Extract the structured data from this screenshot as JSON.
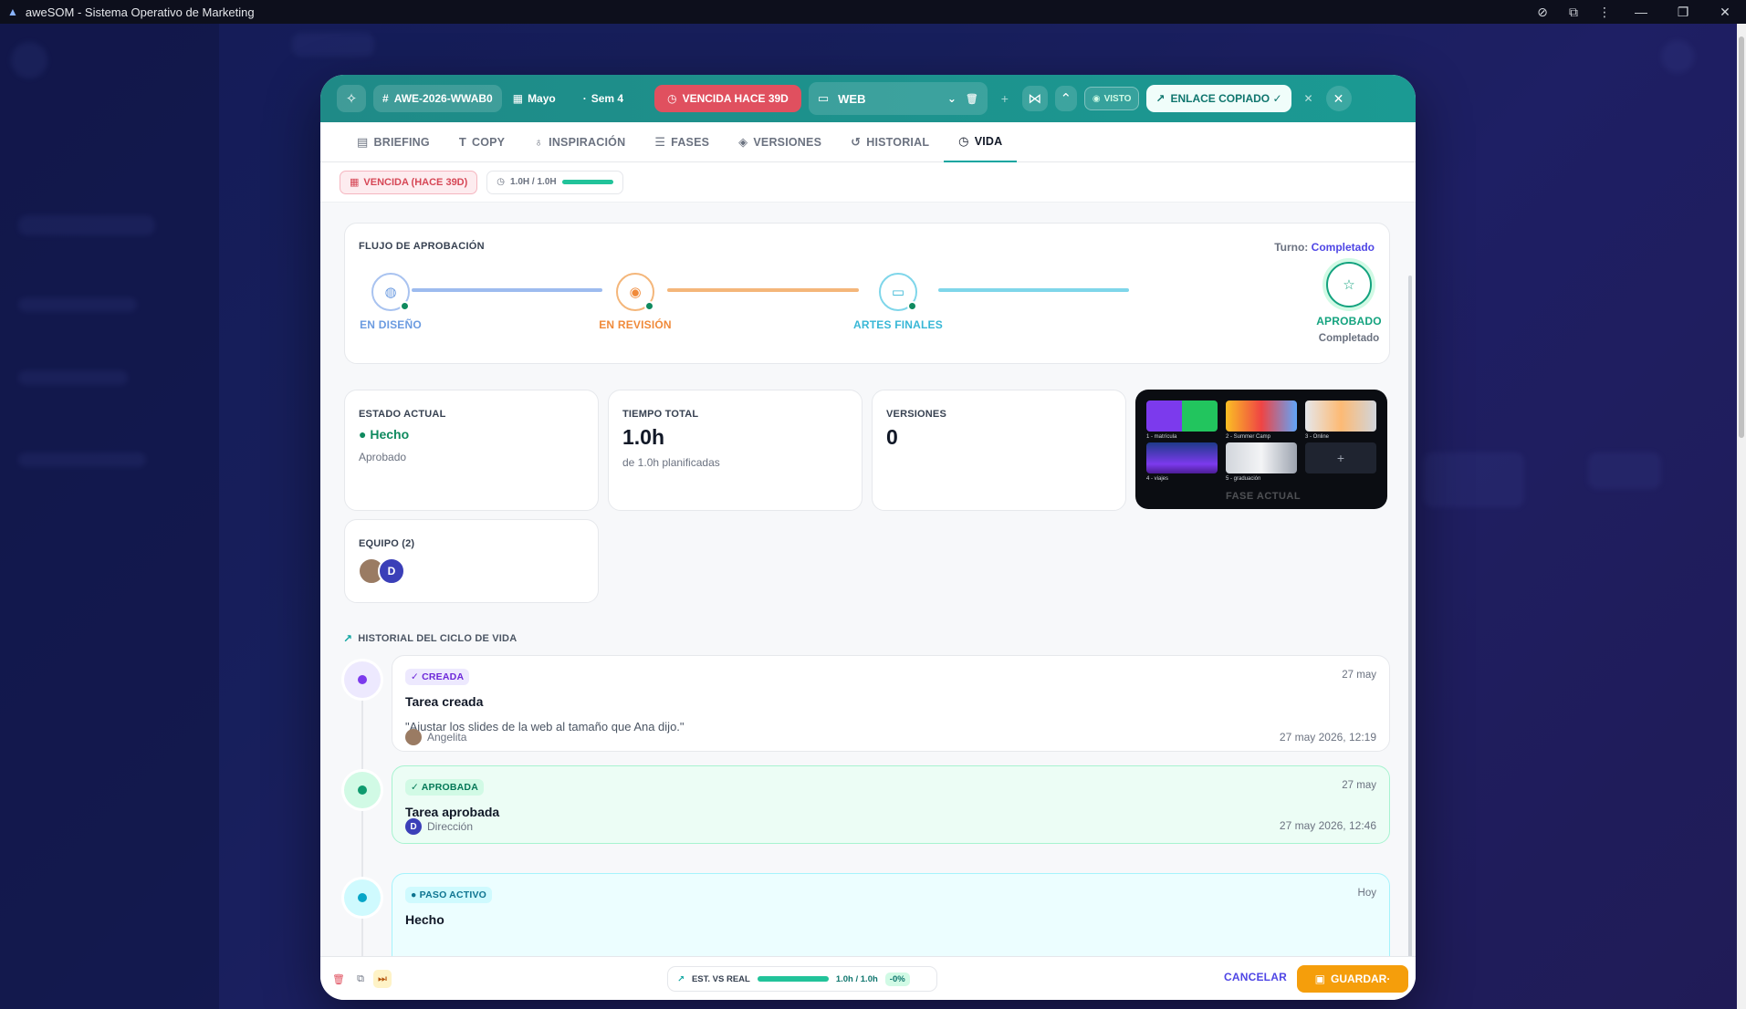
{
  "window": {
    "title": "aweSOM - Sistema Operativo de Marketing"
  },
  "header": {
    "code": "AWE-2026-WWAB0",
    "month": "Mayo",
    "week": "Sem 4",
    "overdue": "VENCIDA HACE 39D",
    "channel": "WEB",
    "seen": "VISTO",
    "link_copied": "ENLACE COPIADO ✓"
  },
  "tabs": [
    {
      "label": "BRIEFING"
    },
    {
      "label": "COPY"
    },
    {
      "label": "INSPIRACIÓN"
    },
    {
      "label": "FASES"
    },
    {
      "label": "VERSIONES"
    },
    {
      "label": "HISTORIAL"
    },
    {
      "label": "VIDA"
    }
  ],
  "subbar": {
    "overdue": "VENCIDA (HACE 39D)",
    "time": "1.0H / 1.0H",
    "time_progress": 1.0
  },
  "flow": {
    "title": "FLUJO DE APROBACIÓN",
    "turn_label": "Turno:",
    "turn_value": "Completado",
    "steps": [
      {
        "label": "EN DISEÑO",
        "color": "#6b9be0"
      },
      {
        "label": "EN REVISIÓN",
        "color": "#f08a3a"
      },
      {
        "label": "ARTES FINALES",
        "color": "#38b7d6"
      },
      {
        "label": "APROBADO",
        "sub": "Completado",
        "color": "#14a37f"
      }
    ]
  },
  "stats": {
    "state_title": "ESTADO ACTUAL",
    "state_value": "● Hecho",
    "state_sub": "Aprobado",
    "time_title": "TIEMPO TOTAL",
    "time_value": "1.0h",
    "time_sub": "de 1.0h planificadas",
    "versions_title": "VERSIONES",
    "versions_value": "0"
  },
  "gallery": {
    "captions": [
      "1 - matrícula",
      "2 - Summer Camp",
      "3 - Online",
      "4 - viajes",
      "5 - graduación"
    ],
    "add": "+",
    "ghost_label": "FASE ACTUAL"
  },
  "team": {
    "title": "EQUIPO (2)",
    "members": [
      {
        "initial": "",
        "color": "#9a7b63"
      },
      {
        "initial": "D",
        "color": "#3b3fb8"
      }
    ]
  },
  "history": {
    "title": "HISTORIAL DEL CICLO DE VIDA",
    "events": [
      {
        "badge": "✓ CREADA",
        "date": "27 may",
        "title": "Tarea creada",
        "quote": "\"Ajustar los slides de la web al tamaño que Ana dijo.\"",
        "user": "Angelita",
        "stamp": "27 may 2026, 12:19"
      },
      {
        "badge": "✓ APROBADA",
        "date": "27 may",
        "title": "Tarea aprobada",
        "user": "Dirección",
        "user_initial": "D",
        "stamp": "27 may 2026, 12:46"
      },
      {
        "badge": "● PASO ACTIVO",
        "date": "Hoy",
        "title": "Hecho"
      }
    ]
  },
  "footer": {
    "est_label": "EST. VS REAL",
    "est_progress": 1.0,
    "est_value": "1.0h / 1.0h",
    "est_delta": "-0%",
    "cancel": "CANCELAR",
    "save": "GUARDAR·"
  },
  "colors": {
    "header_teal": "#1f8a87",
    "danger": "#e0505f",
    "accent_indigo": "#4f46e5",
    "save_amber": "#f59e0b",
    "success": "#0f8a5f"
  }
}
